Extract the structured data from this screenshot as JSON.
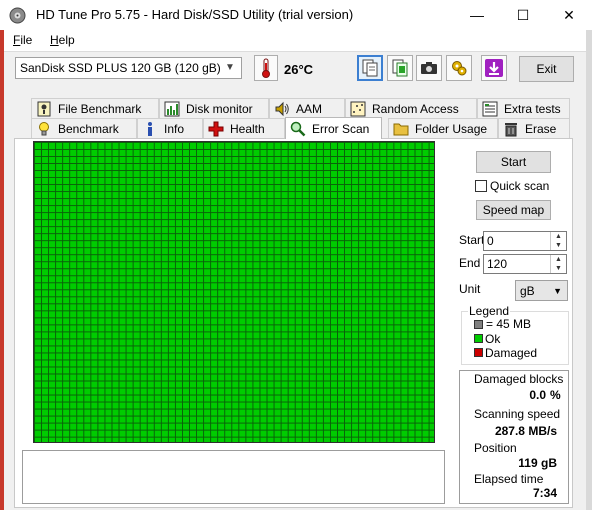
{
  "window": {
    "title": "HD Tune Pro 5.75 - Hard Disk/SSD Utility (trial version)",
    "minimize_glyph": "—",
    "maximize_glyph": "☐",
    "close_glyph": "✕"
  },
  "menu": [
    {
      "label": "File",
      "mnemonic": "F",
      "rest": "ile"
    },
    {
      "label": "Help",
      "mnemonic": "H",
      "rest": "elp"
    }
  ],
  "toolbar": {
    "drive": "SanDisk SSD PLUS 120 GB (120 gB)",
    "temperature": "26°C",
    "exit_label": "Exit",
    "icons": [
      "copy-info-icon",
      "copy-results-icon",
      "screenshot-camera-icon",
      "options-tools-icon",
      "save-download-icon"
    ]
  },
  "tabs_top": [
    {
      "label": "File Benchmark",
      "icon": "file-benchmark-icon"
    },
    {
      "label": "Disk monitor",
      "icon": "disk-monitor-icon"
    },
    {
      "label": "AAM",
      "icon": "speaker-icon"
    },
    {
      "label": "Random Access",
      "icon": "random-access-icon"
    },
    {
      "label": "Extra tests",
      "icon": "extra-tests-icon"
    }
  ],
  "tabs_bottom": [
    {
      "label": "Benchmark",
      "icon": "lightbulb-icon"
    },
    {
      "label": "Info",
      "icon": "info-icon"
    },
    {
      "label": "Health",
      "icon": "health-cross-icon"
    },
    {
      "label": "Error Scan",
      "icon": "magnifier-icon",
      "active": true
    },
    {
      "label": "Folder Usage",
      "icon": "folder-icon"
    },
    {
      "label": "Erase",
      "icon": "trash-icon"
    }
  ],
  "scan": {
    "start_button": "Start",
    "quick_scan_label": "Quick scan",
    "quick_scan_checked": false,
    "speed_map_button": "Speed map",
    "start_label": "Start",
    "start_value": "0",
    "end_label": "End",
    "end_value": "120",
    "unit_label": "Unit",
    "unit_value": "gB",
    "block_state": "all-ok"
  },
  "legend": {
    "title": "Legend",
    "items": [
      {
        "label": "= 45 MB",
        "color": "#808080"
      },
      {
        "label": "Ok",
        "color": "#00cc00"
      },
      {
        "label": "Damaged",
        "color": "#cc0000"
      }
    ]
  },
  "stats": {
    "damaged_label": "Damaged blocks",
    "damaged_value": "0.0",
    "damaged_unit": "%",
    "speed_label": "Scanning speed",
    "speed_value": "287.8 MB/s",
    "position_label": "Position",
    "position_value": "119 gB",
    "elapsed_label": "Elapsed time",
    "elapsed_value": "7:34"
  },
  "colors": {
    "ok_block": "#00cc00",
    "grid_line": "#0a5f0a",
    "active_tool_border": "#3c7fd1"
  }
}
